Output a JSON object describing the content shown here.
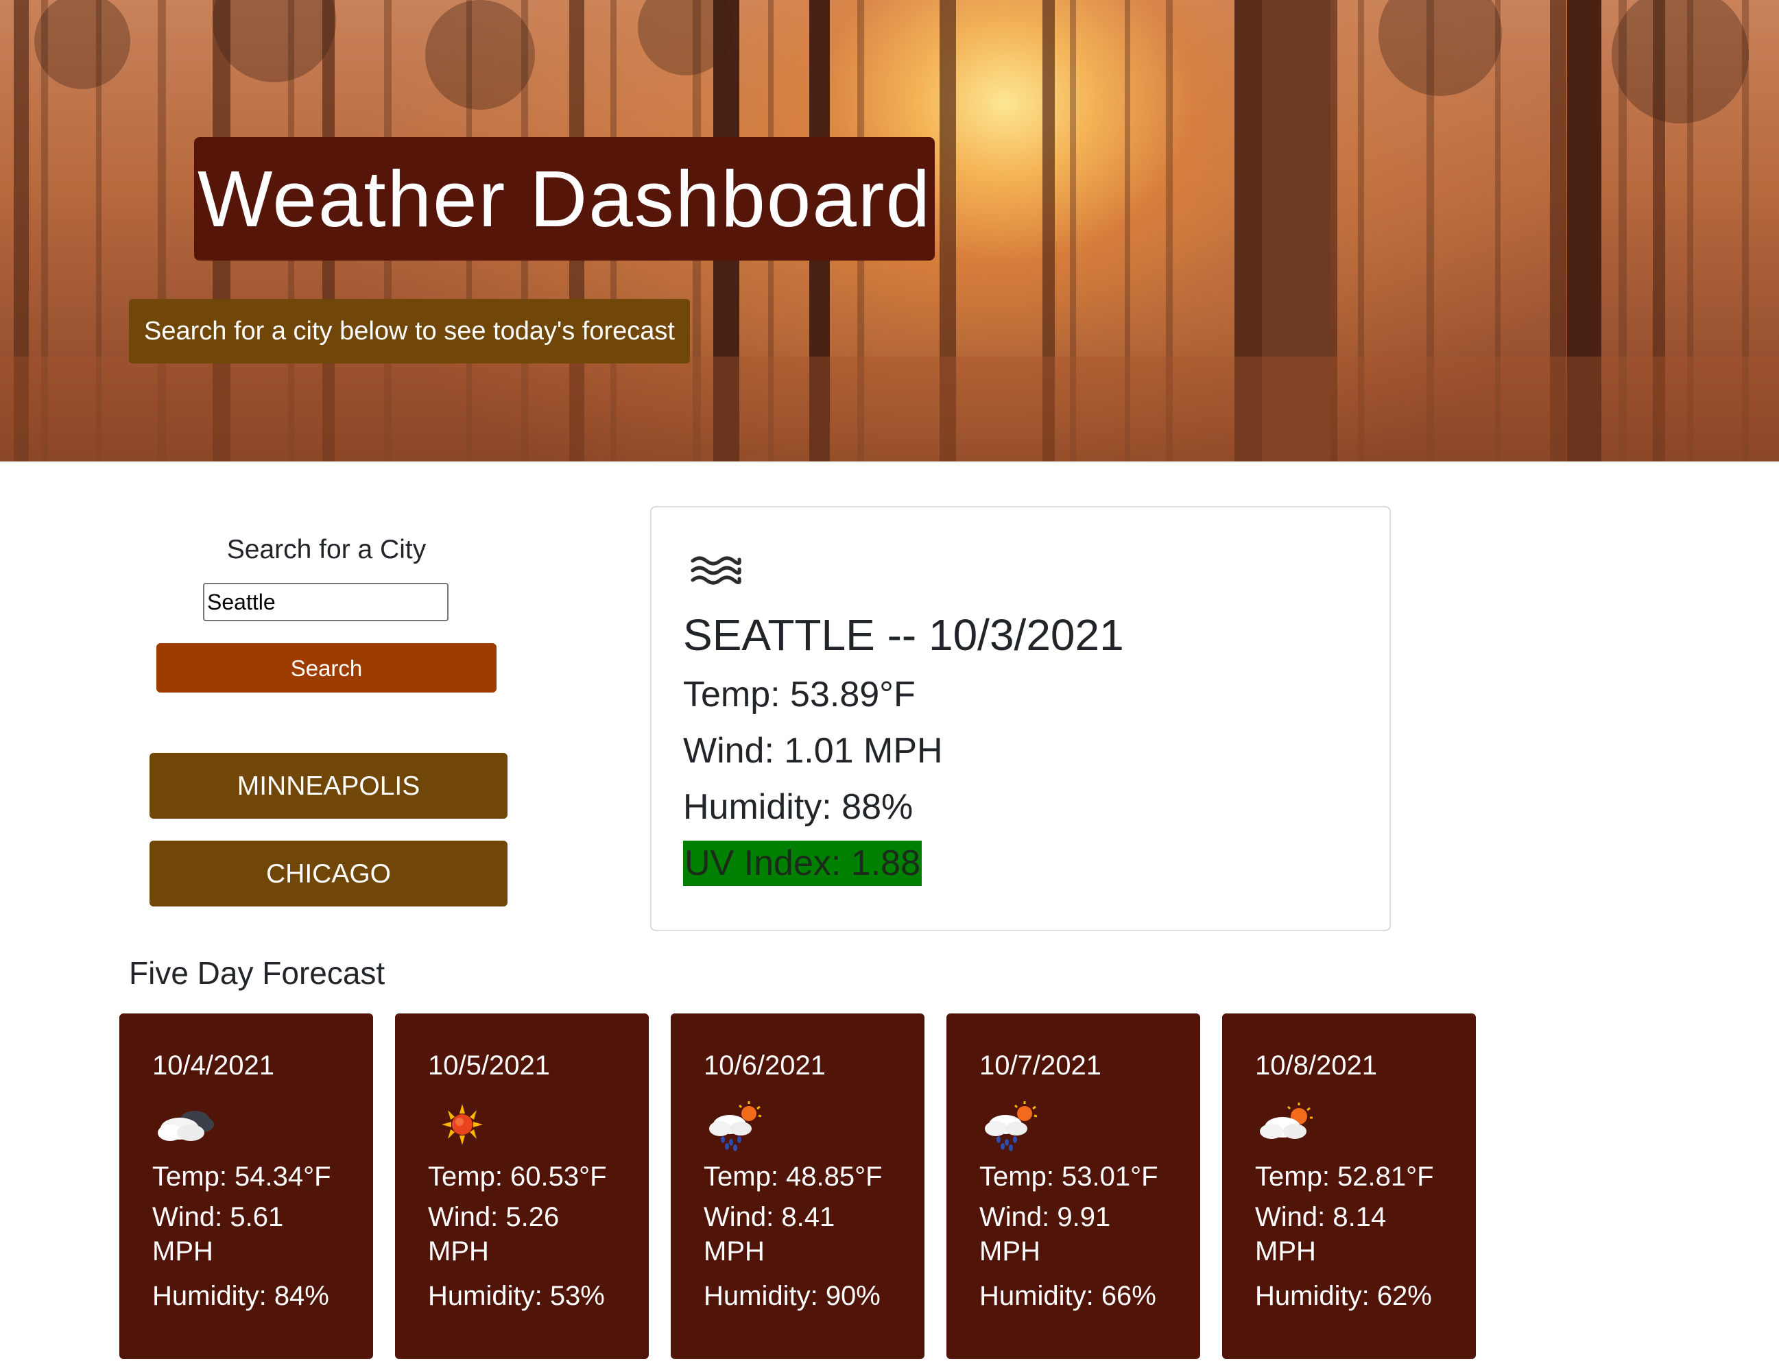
{
  "header": {
    "title": "Weather Dashboard",
    "subtitle": "Search for a city below to see today's forecast"
  },
  "search": {
    "heading": "Search for a City",
    "input_value": "Seattle",
    "button_label": "Search"
  },
  "history": [
    {
      "label": "MINNEAPOLIS"
    },
    {
      "label": "CHICAGO"
    }
  ],
  "current": {
    "icon": "mist-icon",
    "title": "SEATTLE -- 10/3/2021",
    "temp": "Temp: 53.89°F",
    "wind": "Wind: 1.01 MPH",
    "humidity": "Humidity: 88%",
    "uv": "UV Index: 1.88",
    "uv_color": "#008000"
  },
  "forecast": {
    "heading": "Five Day Forecast",
    "days": [
      {
        "date": "10/4/2021",
        "icon": "cloudy-icon",
        "temp": "Temp: 54.34°F",
        "wind": "Wind: 5.61 MPH",
        "humidity": "Humidity: 84%"
      },
      {
        "date": "10/5/2021",
        "icon": "sun-icon",
        "temp": "Temp: 60.53°F",
        "wind": "Wind: 5.26 MPH",
        "humidity": "Humidity: 53%"
      },
      {
        "date": "10/6/2021",
        "icon": "rain-sun-icon",
        "temp": "Temp: 48.85°F",
        "wind": "Wind: 8.41 MPH",
        "humidity": "Humidity: 90%"
      },
      {
        "date": "10/7/2021",
        "icon": "rain-sun-icon",
        "temp": "Temp: 53.01°F",
        "wind": "Wind: 9.91 MPH",
        "humidity": "Humidity: 66%"
      },
      {
        "date": "10/8/2021",
        "icon": "partly-cloudy-icon",
        "temp": "Temp: 52.81°F",
        "wind": "Wind: 8.14 MPH",
        "humidity": "Humidity: 62%"
      }
    ]
  },
  "colors": {
    "title_bg": "#561509",
    "subtitle_bg": "#714709",
    "search_button": "#9e3c00",
    "history_button": "#714709",
    "forecast_card": "#501408",
    "uv_badge": "#008000"
  }
}
